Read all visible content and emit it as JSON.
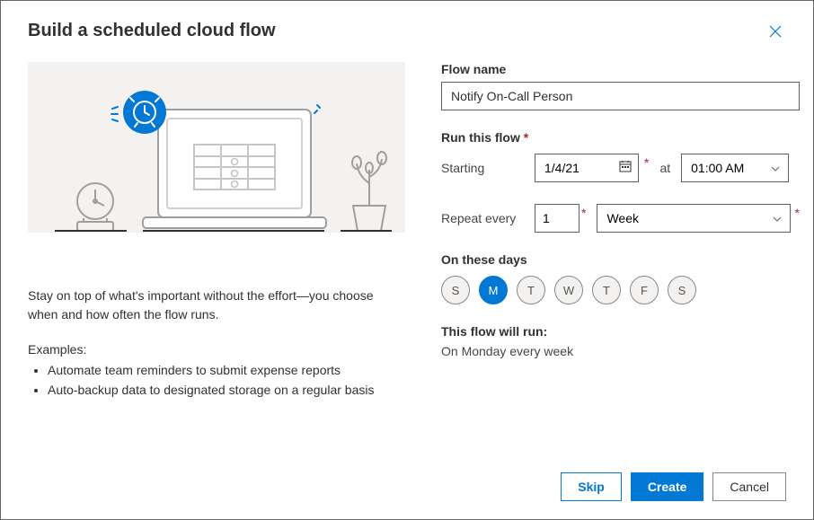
{
  "header": {
    "title": "Build a scheduled cloud flow",
    "close_icon": "close"
  },
  "left": {
    "description": "Stay on top of what's important without the effort—you choose when and how often the flow runs.",
    "examples_heading": "Examples:",
    "examples": [
      "Automate team reminders to submit expense reports",
      "Auto-backup data to designated storage on a regular basis"
    ]
  },
  "form": {
    "flow_name_label": "Flow name",
    "flow_name_value": "Notify On-Call Person",
    "run_label": "Run this flow",
    "starting_label": "Starting",
    "starting_value": "1/4/21",
    "at_label": "at",
    "time_value": "01:00 AM",
    "repeat_label": "Repeat every",
    "interval_value": "1",
    "unit_value": "Week",
    "days_label": "On these days",
    "days": [
      {
        "label": "S",
        "selected": false
      },
      {
        "label": "M",
        "selected": true
      },
      {
        "label": "T",
        "selected": false
      },
      {
        "label": "W",
        "selected": false
      },
      {
        "label": "T",
        "selected": false
      },
      {
        "label": "F",
        "selected": false
      },
      {
        "label": "S",
        "selected": false
      }
    ],
    "summary_label": "This flow will run:",
    "summary_text": "On Monday every week"
  },
  "footer": {
    "skip_label": "Skip",
    "create_label": "Create",
    "cancel_label": "Cancel"
  }
}
